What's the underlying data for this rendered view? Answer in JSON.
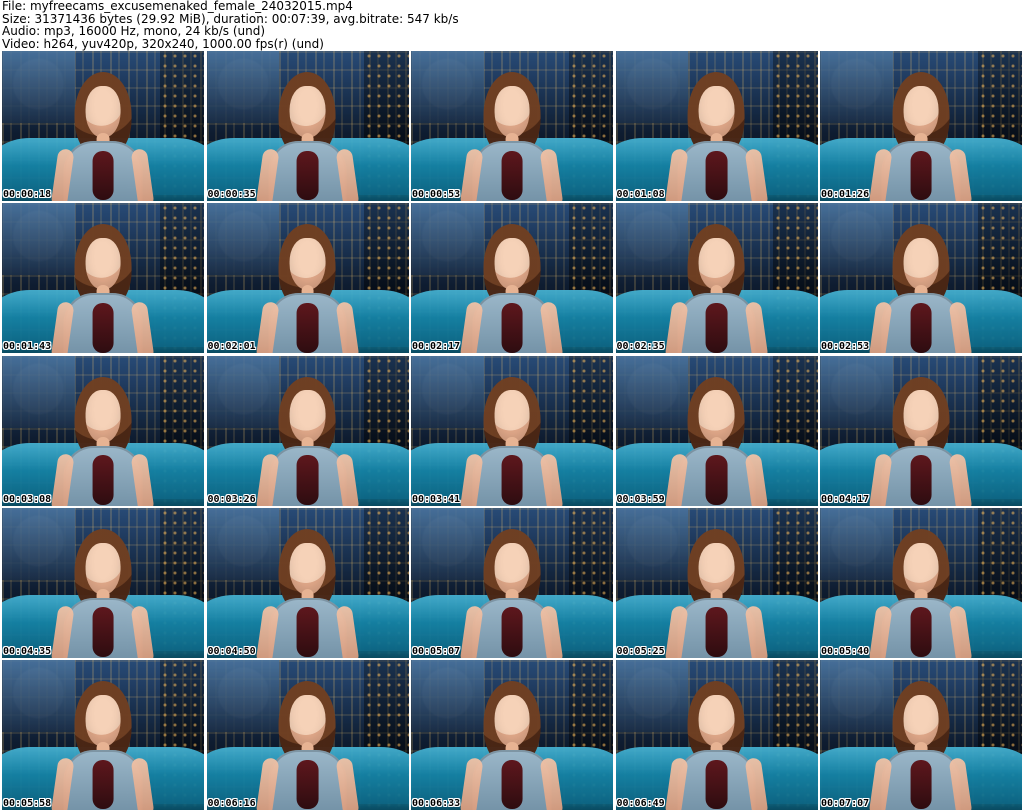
{
  "header": {
    "file": "File: myfreecams_excusemenaked_female_24032015.mp4",
    "size": "Size: 31371436 bytes (29.92 MiB), duration: 00:07:39, avg.bitrate: 547 kb/s",
    "audio": "Audio: mp3, 16000 Hz, mono, 24 kb/s (und)",
    "video": "Video: h264, yuv420p, 320x240, 1000.00 fps(r) (und)"
  },
  "thumbnails": [
    {
      "timestamp": "00:00:18"
    },
    {
      "timestamp": "00:00:35"
    },
    {
      "timestamp": "00:00:53"
    },
    {
      "timestamp": "00:01:08"
    },
    {
      "timestamp": "00:01:26"
    },
    {
      "timestamp": "00:01:43"
    },
    {
      "timestamp": "00:02:01"
    },
    {
      "timestamp": "00:02:17"
    },
    {
      "timestamp": "00:02:35"
    },
    {
      "timestamp": "00:02:53"
    },
    {
      "timestamp": "00:03:08"
    },
    {
      "timestamp": "00:03:26"
    },
    {
      "timestamp": "00:03:41"
    },
    {
      "timestamp": "00:03:59"
    },
    {
      "timestamp": "00:04:17"
    },
    {
      "timestamp": "00:04:35"
    },
    {
      "timestamp": "00:04:50"
    },
    {
      "timestamp": "00:05:07"
    },
    {
      "timestamp": "00:05:25"
    },
    {
      "timestamp": "00:05:40"
    },
    {
      "timestamp": "00:05:58"
    },
    {
      "timestamp": "00:06:16"
    },
    {
      "timestamp": "00:06:33"
    },
    {
      "timestamp": "00:06:49"
    },
    {
      "timestamp": "00:07:07"
    }
  ],
  "colors": {
    "background": "#ffffff",
    "text": "#000000",
    "sofa_blue": "#1d9fc6",
    "denim": "#6f8ea3",
    "hair_brown": "#6f3f22",
    "city_dark": "#0f1c2e"
  }
}
